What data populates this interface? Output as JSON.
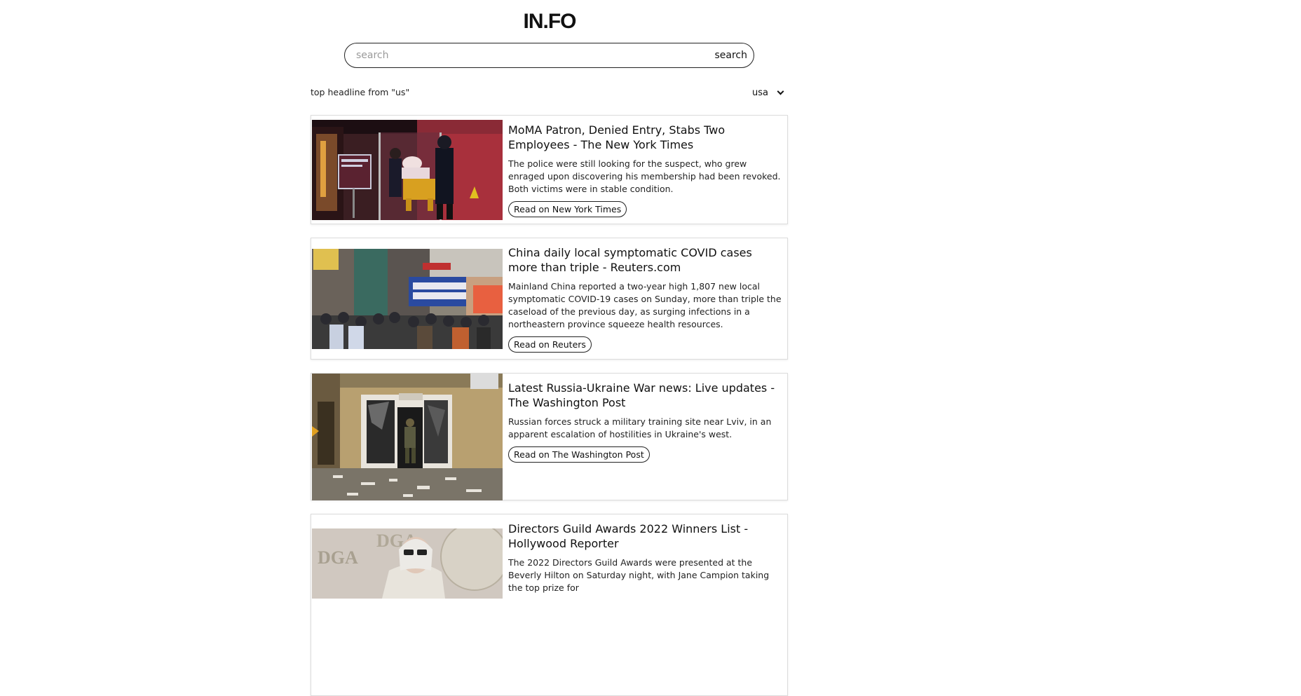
{
  "header": {
    "logo": "IN.FO"
  },
  "search": {
    "placeholder": "search",
    "value": "",
    "button_label": "search"
  },
  "filter": {
    "headline_label": "top headline from \"us\"",
    "country_selected": "usa"
  },
  "articles": [
    {
      "title": "MoMA Patron, Denied Entry, Stabs Two Employees - The New York Times",
      "description": "The police were still looking for the suspect, who grew enraged upon discovering his membership had been revoked. Both victims were in stable condition.",
      "button_label": "Read on New York Times"
    },
    {
      "title": "China daily local symptomatic COVID cases more than triple - Reuters.com",
      "description": "Mainland China reported a two-year high 1,807 new local symptomatic COVID-19 cases on Sunday, more than triple the caseload of the previous day, as surging infections in a northeastern province squeeze health resources.",
      "button_label": "Read on Reuters"
    },
    {
      "title": "Latest Russia-Ukraine War news: Live updates - The Washington Post",
      "description": "Russian forces struck a military training site near Lviv, in an apparent escalation of hostilities in Ukraine's west.",
      "button_label": "Read on The Washington Post"
    },
    {
      "title": "Directors Guild Awards 2022 Winners List - Hollywood Reporter",
      "description": "The 2022 Directors Guild Awards were presented at the Beverly Hilton on Saturday night, with Jane Campion taking the top prize for",
      "button_label": ""
    }
  ],
  "image_text": {
    "dga": "DGA"
  }
}
